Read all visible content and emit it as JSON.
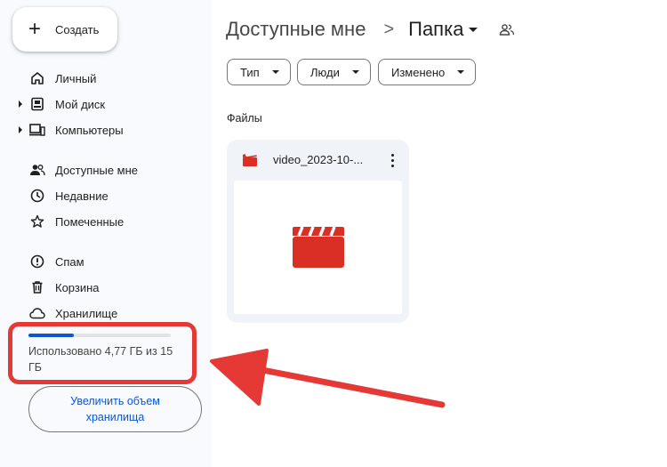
{
  "sidebar": {
    "create_label": "Создать",
    "items": [
      {
        "label": "Личный",
        "icon": "home-icon"
      },
      {
        "label": "Мой диск",
        "icon": "drive-icon"
      },
      {
        "label": "Компьютеры",
        "icon": "computers-icon"
      },
      {
        "label": "Доступные мне",
        "icon": "shared-icon"
      },
      {
        "label": "Недавние",
        "icon": "clock-icon"
      },
      {
        "label": "Помеченные",
        "icon": "star-icon"
      },
      {
        "label": "Спам",
        "icon": "spam-icon"
      },
      {
        "label": "Корзина",
        "icon": "trash-icon"
      },
      {
        "label": "Хранилище",
        "icon": "cloud-icon"
      }
    ],
    "storage": {
      "used_fraction": 0.318,
      "text": "Использовано 4,77 ГБ из 15 ГБ"
    },
    "upgrade_label": "Увеличить объем хранилища"
  },
  "breadcrumb": {
    "parent": "Доступные мне",
    "separator": ">",
    "current": "Папка"
  },
  "filters": [
    "Тип",
    "Люди",
    "Изменено"
  ],
  "files_section": {
    "label": "Файлы",
    "files": [
      {
        "name": "video_2023-10-...",
        "type_icon": "video-icon"
      }
    ]
  },
  "colors": {
    "accent": "#0b57d0",
    "sidebar_bg": "#f8fafd",
    "card_bg": "#f0f4f9",
    "annotation_red": "#e53935",
    "video_red": "#d93025"
  }
}
